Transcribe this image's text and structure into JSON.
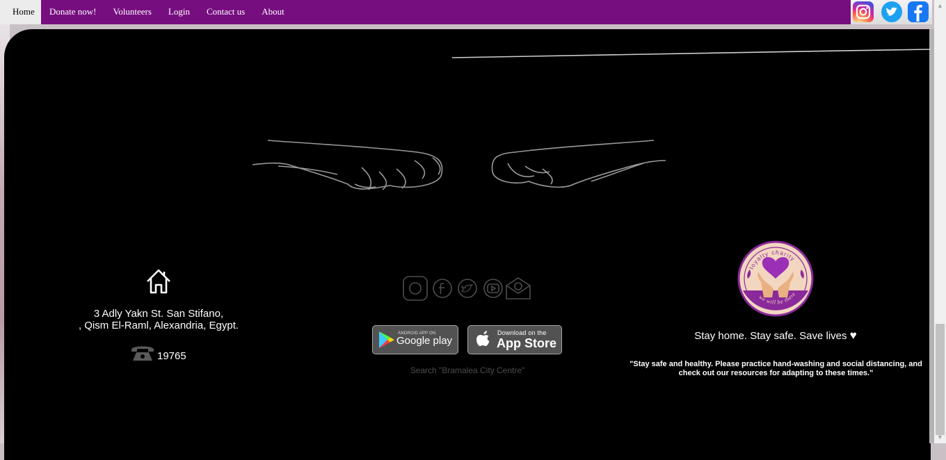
{
  "nav": {
    "items": [
      {
        "label": "Home",
        "active": true
      },
      {
        "label": "Donate now!"
      },
      {
        "label": "Volunteers"
      },
      {
        "label": "Login"
      },
      {
        "label": "Contact us"
      },
      {
        "label": "About"
      }
    ],
    "social_icons": [
      "instagram-icon",
      "twitter-icon",
      "facebook-icon"
    ],
    "color": "#770e80"
  },
  "address": {
    "line1": "3 Adly Yakn St. San Stifano,",
    "line2": ", Qism El-Raml, Alexandria, Egypt.",
    "phone": "19765"
  },
  "middle": {
    "social_icons": [
      "instagram-icon",
      "facebook-icon",
      "twitter-icon",
      "youtube-icon",
      "email-icon"
    ],
    "google_play": {
      "small": "ANDROID APP ON",
      "big": "Google play"
    },
    "app_store": {
      "small": "Download on the",
      "big": "App Store"
    },
    "search_text": "Search \"Bramalea City Centre\""
  },
  "right": {
    "logo_top_text": "loyalty charity",
    "logo_bottom_text": "we will be there",
    "stay_text": "Stay home. Stay safe. Save lives",
    "quote": "\"Stay safe and healthy. Please practice hand-washing and social distancing, and check out our resources for adapting to these times.\""
  }
}
